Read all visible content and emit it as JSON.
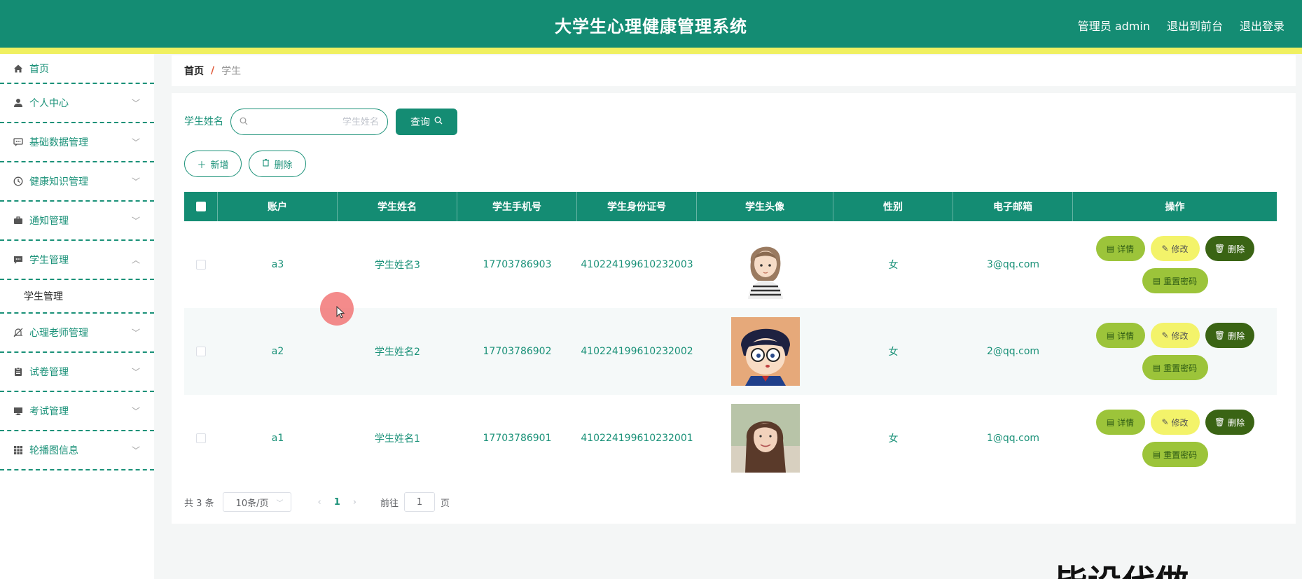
{
  "header": {
    "title": "大学生心理健康管理系统",
    "links": [
      "管理员 admin",
      "退出到前台",
      "退出登录"
    ]
  },
  "sidebar": {
    "items": [
      {
        "label": "首页",
        "icon": "home-icon"
      },
      {
        "label": "个人中心",
        "icon": "user-icon"
      },
      {
        "label": "基础数据管理",
        "icon": "chat-icon"
      },
      {
        "label": "健康知识管理",
        "icon": "clock-icon"
      },
      {
        "label": "通知管理",
        "icon": "briefcase-icon"
      },
      {
        "label": "学生管理",
        "icon": "message-icon",
        "expanded": true
      },
      {
        "label": "心理老师管理",
        "icon": "bell-off-icon"
      },
      {
        "label": "试卷管理",
        "icon": "clipboard-icon"
      },
      {
        "label": "考试管理",
        "icon": "monitor-icon"
      },
      {
        "label": "轮播图信息",
        "icon": "grid-icon"
      }
    ],
    "sub_item": "学生管理"
  },
  "breadcrumb": {
    "home": "首页",
    "sep": "/",
    "current": "学生"
  },
  "search": {
    "label": "学生姓名",
    "placeholder": "学生姓名",
    "button": "查询"
  },
  "actions": {
    "add": "新增",
    "delete": "删除"
  },
  "table": {
    "headers": [
      "账户",
      "学生姓名",
      "学生手机号",
      "学生身份证号",
      "学生头像",
      "性别",
      "电子邮箱",
      "操作"
    ],
    "rows": [
      {
        "account": "a3",
        "name": "学生姓名3",
        "phone": "17703786903",
        "id": "410224199610232003",
        "avatar": "girl-cartoon",
        "gender": "女",
        "email": "3@qq.com"
      },
      {
        "account": "a2",
        "name": "学生姓名2",
        "phone": "17703786902",
        "id": "410224199610232002",
        "avatar": "boy-cartoon",
        "gender": "女",
        "email": "2@qq.com"
      },
      {
        "account": "a1",
        "name": "学生姓名1",
        "phone": "17703786901",
        "id": "410224199610232001",
        "avatar": "woman-photo",
        "gender": "女",
        "email": "1@qq.com"
      }
    ],
    "ops": {
      "detail": "详情",
      "edit": "修改",
      "delete": "删除",
      "reset": "重置密码"
    }
  },
  "pagination": {
    "total": "共 3 条",
    "page_size": "10条/页",
    "current": "1",
    "goto_label": "前往",
    "goto_value": "1",
    "page_unit": "页"
  },
  "watermark": "毕设代做"
}
